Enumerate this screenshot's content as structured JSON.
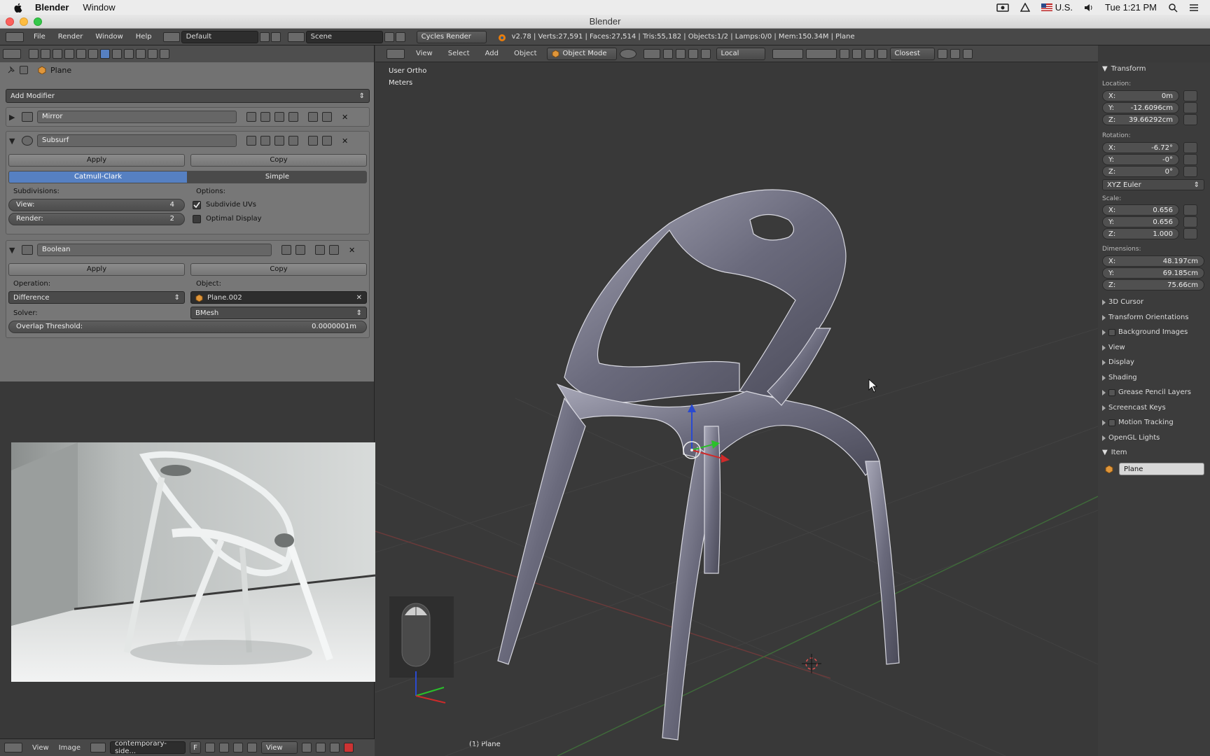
{
  "mac_menubar": {
    "app_name": "Blender",
    "menu_window": "Window",
    "locale": "U.S.",
    "clock": "Tue 1:21 PM"
  },
  "window": {
    "title": "Blender"
  },
  "info_header": {
    "menus": [
      "File",
      "Render",
      "Window",
      "Help"
    ],
    "layout": "Default",
    "scene": "Scene",
    "engine": "Cycles Render",
    "stats": "v2.78 | Verts:27,591 | Faces:27,514 | Tris:55,182 | Objects:1/2 | Lamps:0/0 | Mem:150.34M | Plane"
  },
  "properties": {
    "context_object": "Plane",
    "add_modifier": "Add Modifier",
    "mirror": {
      "name": "Mirror"
    },
    "subsurf": {
      "name": "Subsurf",
      "apply": "Apply",
      "copy": "Copy",
      "type_catmull": "Catmull-Clark",
      "type_simple": "Simple",
      "subdivisions_label": "Subdivisions:",
      "options_label": "Options:",
      "view_label": "View:",
      "view_value": "4",
      "render_label": "Render:",
      "render_value": "2",
      "subdivide_uvs": "Subdivide UVs",
      "optimal_display": "Optimal Display"
    },
    "boolean": {
      "name": "Boolean",
      "apply": "Apply",
      "copy": "Copy",
      "operation_label": "Operation:",
      "operation_value": "Difference",
      "object_label": "Object:",
      "object_value": "Plane.002",
      "solver_label": "Solver:",
      "solver_value": "BMesh",
      "overlap_label": "Overlap Threshold:",
      "overlap_value": "0.0000001m"
    }
  },
  "image_editor": {
    "menus": [
      "View",
      "Image"
    ],
    "image_name": "contemporary-side...",
    "f_label": "F",
    "view_label": "View"
  },
  "viewport": {
    "menus": [
      "View",
      "Select",
      "Add",
      "Object"
    ],
    "mode": "Object Mode",
    "pivot": "Local",
    "snap": "Closest",
    "overlay_view": "User Ortho",
    "overlay_units": "Meters",
    "overlay_object": "(1) Plane"
  },
  "n_panel": {
    "transform": "Transform",
    "location_label": "Location:",
    "location": [
      {
        "axis": "X:",
        "value": "0m"
      },
      {
        "axis": "Y:",
        "value": "-12.6096cm"
      },
      {
        "axis": "Z:",
        "value": "39.66292cm"
      }
    ],
    "rotation_label": "Rotation:",
    "rotation": [
      {
        "axis": "X:",
        "value": "-6.72°"
      },
      {
        "axis": "Y:",
        "value": "-0°"
      },
      {
        "axis": "Z:",
        "value": "0°"
      }
    ],
    "rotation_mode": "XYZ Euler",
    "scale_label": "Scale:",
    "scale": [
      {
        "axis": "X:",
        "value": "0.656"
      },
      {
        "axis": "Y:",
        "value": "0.656"
      },
      {
        "axis": "Z:",
        "value": "1.000"
      }
    ],
    "dimensions_label": "Dimensions:",
    "dimensions": [
      {
        "axis": "X:",
        "value": "48.197cm"
      },
      {
        "axis": "Y:",
        "value": "69.185cm"
      },
      {
        "axis": "Z:",
        "value": "75.66cm"
      }
    ],
    "sections": [
      "3D Cursor",
      "Transform Orientations",
      "Background Images",
      "View",
      "Display",
      "Shading",
      "Grease Pencil Layers",
      "Screencast Keys",
      "Motion Tracking",
      "OpenGL Lights"
    ],
    "item_label": "Item",
    "item_name": "Plane"
  }
}
